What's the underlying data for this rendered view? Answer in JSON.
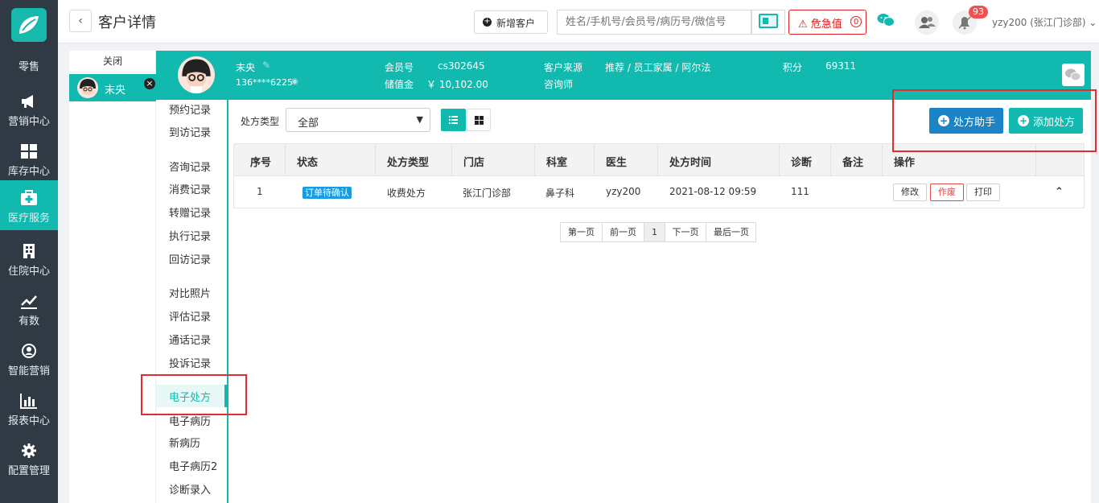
{
  "nav": {
    "items": [
      {
        "label": "零售",
        "icon": "logo-icon"
      },
      {
        "label": "营销中心",
        "icon": "megaphone-icon"
      },
      {
        "label": "库存中心",
        "icon": "grid-icon"
      },
      {
        "label": "医疗服务",
        "icon": "medkit-icon"
      },
      {
        "label": "住院中心",
        "icon": "building-icon"
      },
      {
        "label": "有数",
        "icon": "trend-icon"
      },
      {
        "label": "智能营销",
        "icon": "smart-icon"
      },
      {
        "label": "报表中心",
        "icon": "bar-chart-icon"
      },
      {
        "label": "配置管理",
        "icon": "gear-icon"
      }
    ],
    "active": "医疗服务"
  },
  "header": {
    "title": "客户详情",
    "new_customer": "新增客户",
    "search_placeholder": "姓名/手机号/会员号/病历号/微信号",
    "danger_label": "危急值",
    "danger_count": "0",
    "notify_count": "93",
    "user": "yzy200 (张江门诊部)"
  },
  "tabs": {
    "close_label": "关闭",
    "active_tab": "末央"
  },
  "customer": {
    "name": "末央",
    "phone": "136****6225",
    "member_no_label": "会员号",
    "member_no": "cs302645",
    "balance_label": "储值金",
    "balance": "￥ 10,102.00",
    "source_label": "客户来源",
    "source": "推荐 / 员工家属 / 阿尔法",
    "consultant_label": "咨询师",
    "points_label": "积分",
    "points": "69311"
  },
  "side_menu": {
    "groups": [
      [
        "预约记录",
        "到访记录"
      ],
      [
        "咨询记录",
        "消费记录",
        "转赠记录",
        "执行记录",
        "回访记录"
      ],
      [
        "对比照片",
        "评估记录",
        "通话记录",
        "投诉记录"
      ],
      [
        "电子处方",
        "电子病历",
        "新病历",
        "电子病历2",
        "诊断录入"
      ]
    ],
    "selected": "电子处方"
  },
  "filter": {
    "type_label": "处方类型",
    "type_value": "全部"
  },
  "actions": {
    "helper": "处方助手",
    "add": "添加处方"
  },
  "table": {
    "columns": [
      "序号",
      "状态",
      "处方类型",
      "门店",
      "科室",
      "医生",
      "处方时间",
      "诊断",
      "备注",
      "操作"
    ],
    "rows": [
      {
        "no": "1",
        "status": "订单待确认",
        "type": "收费处方",
        "store": "张江门诊部",
        "dept": "鼻子科",
        "doctor": "yzy200",
        "time": "2021-08-12 09:59",
        "diagnosis": "111",
        "note": "",
        "ops": [
          "修改",
          "作废",
          "打印"
        ]
      }
    ]
  },
  "pager": {
    "first": "第一页",
    "prev": "前一页",
    "current": "1",
    "next": "下一页",
    "last": "最后一页"
  },
  "colors": {
    "accent": "#12b9ae",
    "nav_bg": "#2f3a44",
    "helper_btn": "#1a84c6",
    "danger": "#e02020",
    "highlight_box": "#e52b2b"
  }
}
